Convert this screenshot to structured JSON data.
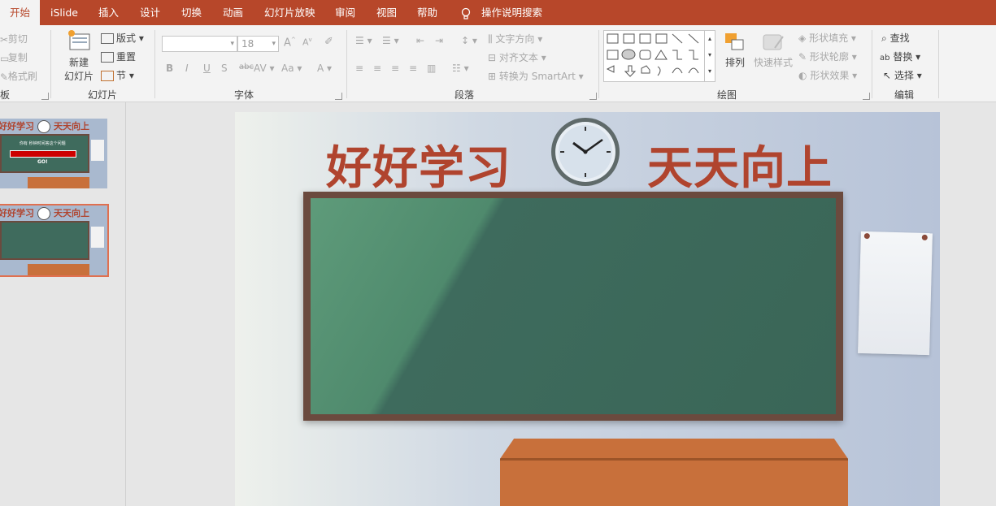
{
  "tabs": [
    "开始",
    "iSlide",
    "插入",
    "设计",
    "切换",
    "动画",
    "幻灯片放映",
    "审阅",
    "视图",
    "帮助"
  ],
  "tell_me": "操作说明搜索",
  "clipboard": {
    "cut": "剪切",
    "copy": "复制",
    "format_painter": "格式刷",
    "label": "板"
  },
  "slides_group": {
    "new_slide_1": "新建",
    "new_slide_2": "幻灯片",
    "layout": "版式",
    "reset": "重置",
    "section": "节",
    "label": "幻灯片"
  },
  "font": {
    "size": "18",
    "label": "字体"
  },
  "paragraph": {
    "text_direction": "文字方向",
    "align_text": "对齐文本",
    "convert_smartart": "转换为 SmartArt",
    "label": "段落"
  },
  "drawing": {
    "arrange": "排列",
    "quick_styles": "快速样式",
    "shape_fill": "形状填充",
    "shape_outline": "形状轮廓",
    "shape_effects": "形状效果",
    "label": "绘图"
  },
  "editing": {
    "find": "查找",
    "replace": "替换",
    "select": "选择",
    "label": "编辑"
  },
  "slide": {
    "title_left": "好好学习",
    "title_right": "天天向上"
  },
  "thumb1": {
    "title_left": "好好学习",
    "title_right": "天天向上",
    "subtitle": "你有 秒钟时间答这个问题",
    "go": "GO!"
  },
  "thumb2": {
    "title_left": "好好学习",
    "title_right": "天天向上"
  },
  "colors": {
    "accent": "#b7472a",
    "board": "#3f6b5d",
    "frame": "#6b4a3e",
    "title": "#b0442e",
    "desk": "#c8703b"
  }
}
